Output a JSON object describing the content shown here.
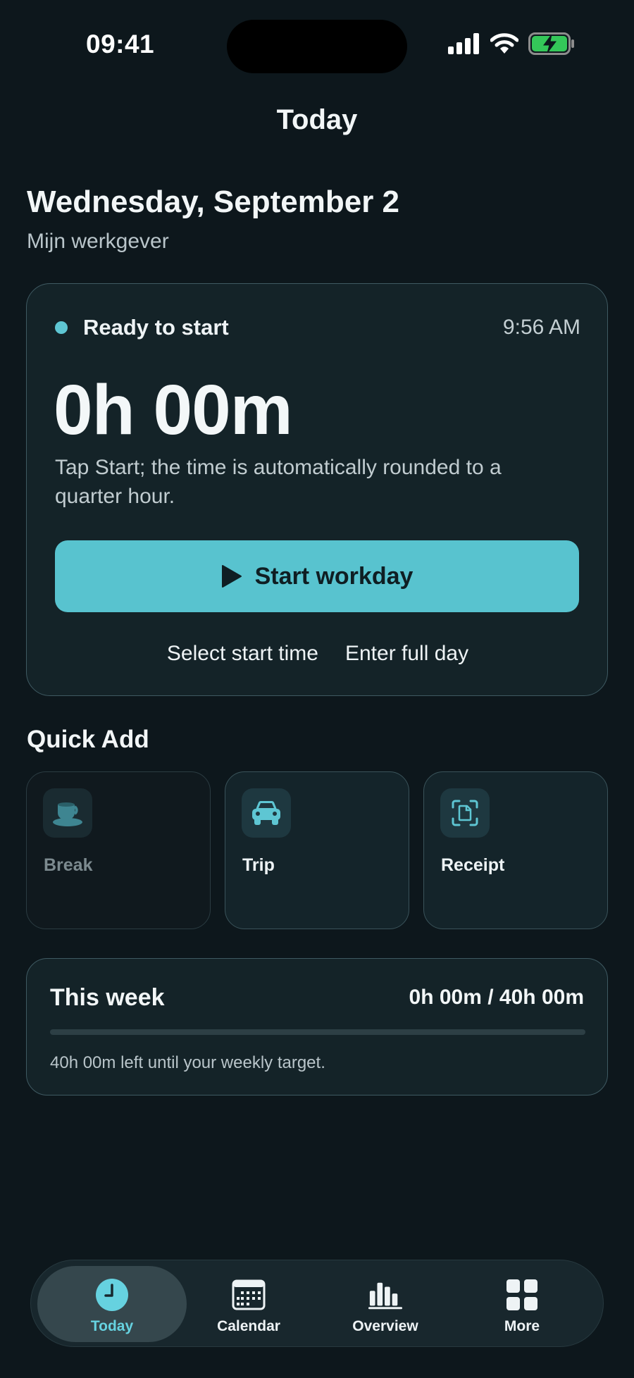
{
  "status_bar": {
    "time": "09:41"
  },
  "header": {
    "title": "Today"
  },
  "day": {
    "date": "Wednesday, September 2",
    "employer": "Mijn werkgever"
  },
  "timer_card": {
    "status": "Ready to start",
    "current_time": "9:56 AM",
    "elapsed": "0h 00m",
    "hint": "Tap Start; the time is automatically rounded to a quarter hour.",
    "start_button": "Start workday",
    "select_start_time": "Select start time",
    "enter_full_day": "Enter full day"
  },
  "quick_add": {
    "title": "Quick Add",
    "items": [
      {
        "label": "Break",
        "icon": "coffee-cup-icon",
        "enabled": false
      },
      {
        "label": "Trip",
        "icon": "car-icon",
        "enabled": true
      },
      {
        "label": "Receipt",
        "icon": "receipt-scan-icon",
        "enabled": true
      }
    ]
  },
  "week": {
    "title": "This week",
    "value": "0h 00m / 40h 00m",
    "progress": 0,
    "note": "40h 00m left until your weekly target."
  },
  "tabs": [
    {
      "label": "Today",
      "icon": "clock-icon",
      "active": true
    },
    {
      "label": "Calendar",
      "icon": "calendar-icon",
      "active": false
    },
    {
      "label": "Overview",
      "icon": "bar-chart-icon",
      "active": false
    },
    {
      "label": "More",
      "icon": "grid-icon",
      "active": false
    }
  ],
  "colors": {
    "background": "#0d171c",
    "card": "#142328",
    "accent": "#58c3cf",
    "active_tab_text": "#66d2e0",
    "battery": "#34c759"
  }
}
